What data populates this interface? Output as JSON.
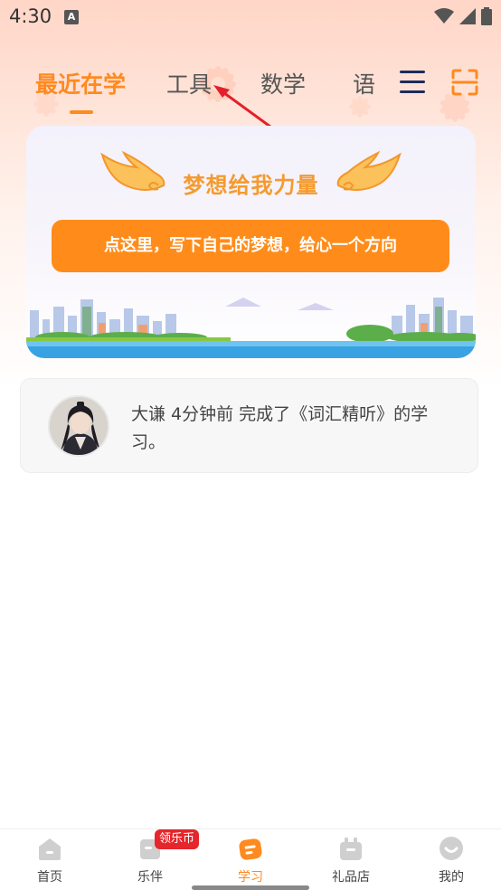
{
  "status_bar": {
    "time": "4:30",
    "notif_glyph": "A"
  },
  "tabs": [
    {
      "label": "最近在学",
      "active": true
    },
    {
      "label": "工具",
      "active": false
    },
    {
      "label": "数学",
      "active": false
    },
    {
      "label": "语",
      "active": false
    }
  ],
  "dream": {
    "title": "梦想给我力量",
    "button_label": "点这里，写下自己的梦想，给心一个方向"
  },
  "activity": {
    "text": "大谦 4分钟前 完成了《词汇精听》的学习。"
  },
  "bottom_nav": {
    "items": [
      {
        "label": "首页",
        "icon": "home-icon"
      },
      {
        "label": "乐伴",
        "icon": "companion-icon"
      },
      {
        "label": "学习",
        "icon": "study-icon"
      },
      {
        "label": "礼品店",
        "icon": "gift-shop-icon"
      },
      {
        "label": "我的",
        "icon": "profile-icon"
      }
    ],
    "badge": "领乐币"
  },
  "colors": {
    "accent": "#ff8a1f",
    "badge": "#e5262b",
    "nav_dark": "#1d2b5c"
  }
}
